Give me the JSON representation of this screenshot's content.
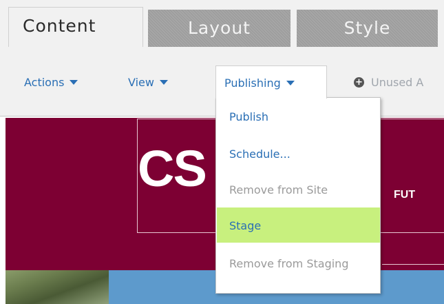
{
  "tabs": [
    {
      "label": "Content"
    },
    {
      "label": "Layout"
    },
    {
      "label": "Style"
    }
  ],
  "toolbar": {
    "actions": "Actions",
    "view": "View",
    "publishing": "Publishing",
    "unused": "Unused A"
  },
  "dropdown": {
    "items": [
      {
        "label": "Publish",
        "enabled": true
      },
      {
        "label": "Schedule...",
        "enabled": true
      },
      {
        "label": "Remove from Site",
        "enabled": false
      },
      {
        "label": "Stage",
        "enabled": true,
        "highlighted": true
      },
      {
        "label": "Remove from Staging",
        "enabled": false
      }
    ]
  },
  "preview": {
    "logo_text": "CS",
    "nav_text": "FUT"
  },
  "colors": {
    "brand": "#7d0033",
    "link": "#2a6fb5",
    "highlight": "#c8f07e"
  },
  "icons": {
    "caret": "caret-down-icon",
    "unused": "plus-circle-icon"
  }
}
